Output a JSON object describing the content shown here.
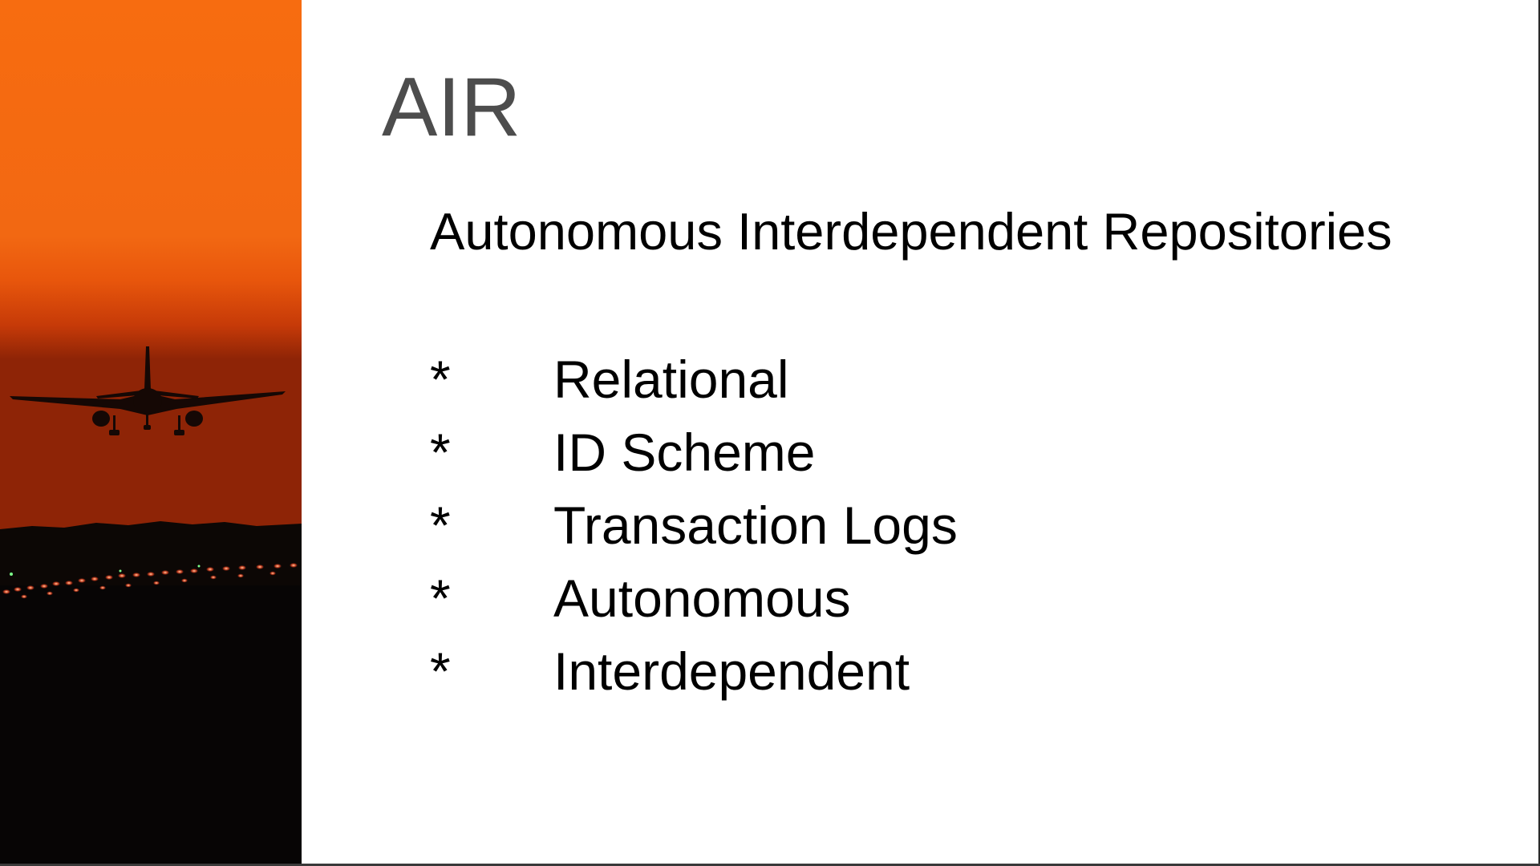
{
  "slide": {
    "title": "AIR",
    "subtitle": "Autonomous Interdependent Repositories",
    "bullets": [
      {
        "marker": "*",
        "text": "Relational"
      },
      {
        "marker": "*",
        "text": "ID Scheme"
      },
      {
        "marker": "*",
        "text": "Transaction Logs"
      },
      {
        "marker": "*",
        "text": "Autonomous"
      },
      {
        "marker": "*",
        "text": "Interdependent"
      }
    ]
  },
  "image": {
    "subject": "airplane-landing-sunset-photo",
    "colors": {
      "sky_top": "#f47014",
      "sky_horizon": "#c93a06",
      "ground": "#080606"
    }
  }
}
